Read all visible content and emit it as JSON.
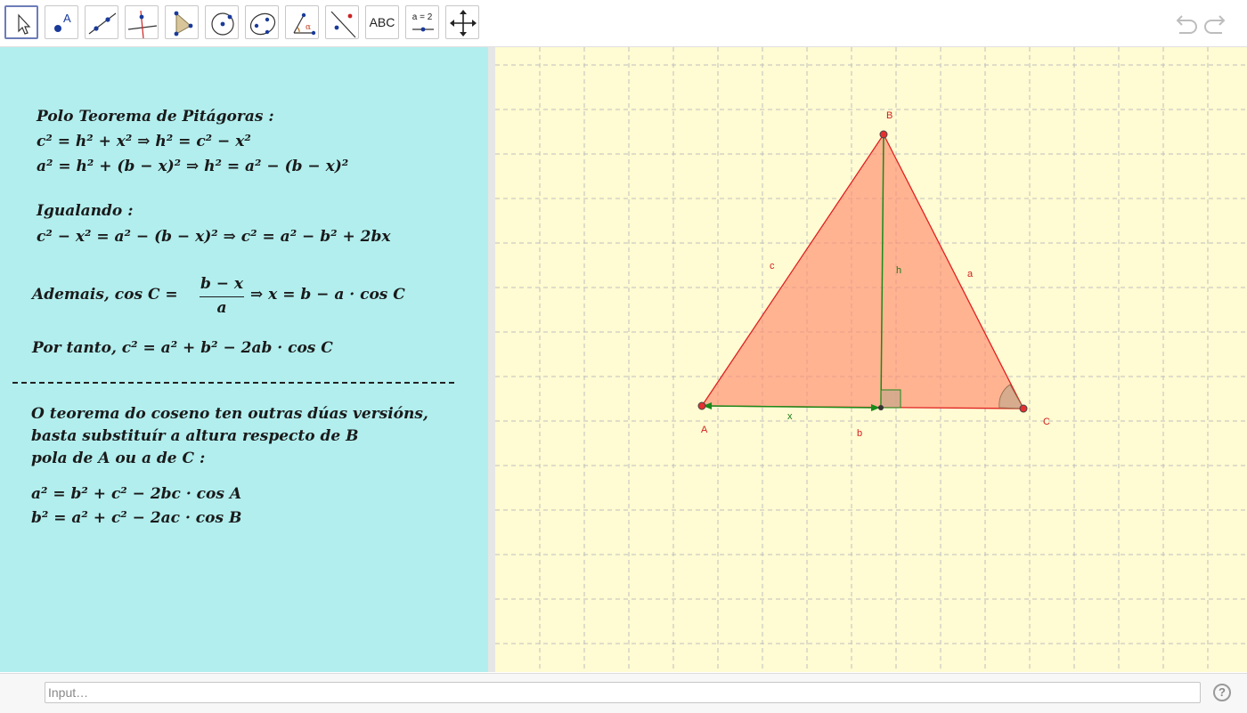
{
  "toolbar": {
    "tools": [
      {
        "name": "move-tool",
        "icon": "cursor-arrow-icon"
      },
      {
        "name": "point-tool",
        "icon": "point-icon",
        "label": "A"
      },
      {
        "name": "line-tool",
        "icon": "line-through-two-points-icon"
      },
      {
        "name": "perpendicular-line-tool",
        "icon": "perpendicular-line-icon"
      },
      {
        "name": "polygon-tool",
        "icon": "polygon-icon"
      },
      {
        "name": "circle-tool",
        "icon": "circle-center-point-icon"
      },
      {
        "name": "conic-tool",
        "icon": "ellipse-icon"
      },
      {
        "name": "angle-tool",
        "icon": "angle-icon",
        "label": "α"
      },
      {
        "name": "reflect-tool",
        "icon": "reflect-about-line-icon"
      },
      {
        "name": "text-tool",
        "icon": "text-icon",
        "label": "ABC"
      },
      {
        "name": "slider-tool",
        "icon": "slider-icon",
        "label": "a = 2"
      },
      {
        "name": "move-graphics-view-tool",
        "icon": "move-graphics-view-icon"
      }
    ],
    "undo_icon": "undo-icon",
    "redo_icon": "redo-icon"
  },
  "algebra": {
    "background": "#b2eeee",
    "lines": [
      "Polo Teorema de Pitágoras :",
      "c² = h² + x² ⇒ h² = c² − x²",
      "a² = h² + (b − x)² ⇒ h² = a² − (b − x)²",
      "Igualando :",
      "c² − x² = a² − (b − x)² ⇒ c² = a² − b² + 2bx"
    ],
    "ademais_prefix": "Ademais,  cos C =",
    "ademais_numerator": "b − x",
    "ademais_denominator": "a",
    "ademais_suffix": "⇒ x = b − a · cos  C",
    "por_tanto": "Por tanto,  c² = a² + b² − 2ab · cos  C",
    "note_lines": [
      "O teorema do coseno ten outras dúas versións,",
      "basta substituír a altura respecto de B",
      "pola de A ou a de C :"
    ],
    "formula_a": "a² = b² + c² − 2bc · cos A",
    "formula_b": "b² = a² + c² − 2ac · cos B"
  },
  "graphics": {
    "background": "#fffbd2",
    "triangle_color": "#ff0000",
    "fill_color": "#ff8c6e",
    "height_color": "#008000",
    "labels": {
      "A": "A",
      "B": "B",
      "C": "C",
      "a": "a",
      "b": "b",
      "c": "c",
      "h": "h",
      "x": "x"
    }
  },
  "input_bar": {
    "placeholder": "Input…",
    "help_icon": "help-question-icon",
    "help_label": "?"
  }
}
